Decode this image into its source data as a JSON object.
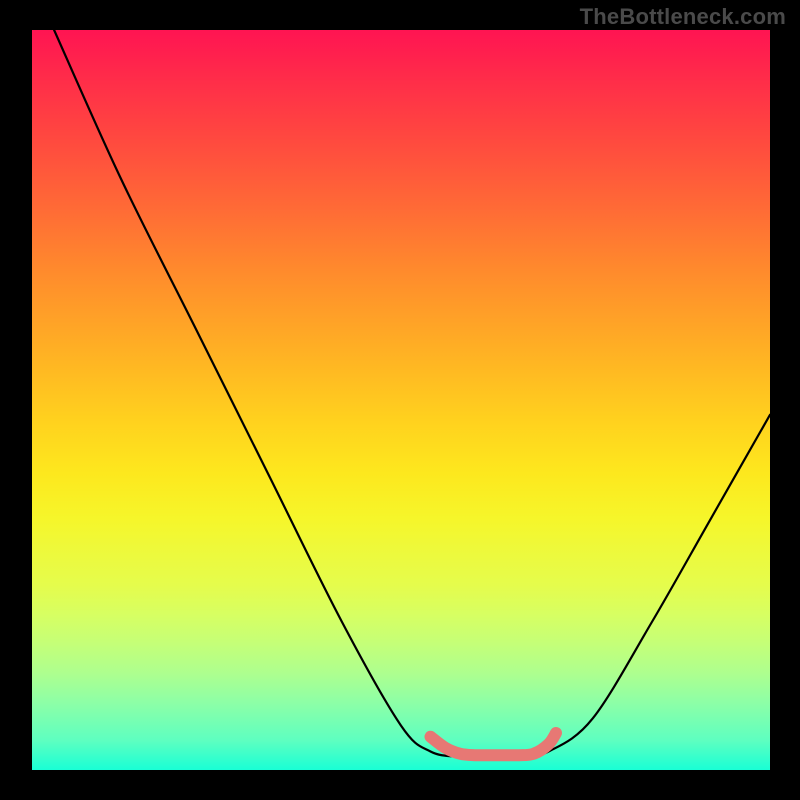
{
  "watermark": "TheBottleneck.com",
  "chart_data": {
    "type": "line",
    "title": "",
    "xlabel": "",
    "ylabel": "",
    "xlim": [
      0,
      1
    ],
    "ylim": [
      0,
      1
    ],
    "grid": false,
    "legend": false,
    "series": [
      {
        "name": "main-curve",
        "color": "#000000",
        "x": [
          0.03,
          0.12,
          0.22,
          0.32,
          0.42,
          0.5,
          0.54,
          0.58,
          0.62,
          0.66,
          0.7,
          0.76,
          0.84,
          0.92,
          1.0
        ],
        "y": [
          1.0,
          0.8,
          0.6,
          0.4,
          0.2,
          0.06,
          0.025,
          0.018,
          0.018,
          0.018,
          0.025,
          0.07,
          0.2,
          0.34,
          0.48
        ]
      },
      {
        "name": "highlight-segment",
        "color": "#e77874",
        "x": [
          0.54,
          0.56,
          0.58,
          0.6,
          0.62,
          0.64,
          0.66,
          0.68,
          0.7,
          0.71
        ],
        "y": [
          0.045,
          0.03,
          0.022,
          0.02,
          0.02,
          0.02,
          0.02,
          0.022,
          0.035,
          0.05
        ]
      }
    ],
    "gradient_colors": {
      "top": "#ff1452",
      "bottom": "#19ffd5"
    }
  }
}
